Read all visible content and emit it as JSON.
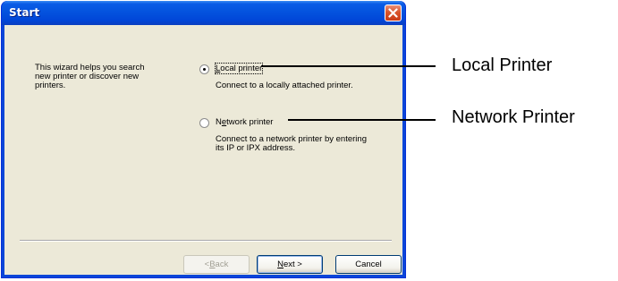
{
  "window": {
    "title": "Start",
    "close_icon": "close-icon"
  },
  "intro_text": "This wizard helps you search new printer or discover new printers.",
  "options": [
    {
      "label": "Local printer",
      "mnemonic": "L",
      "description": "Connect to a locally attached printer.",
      "selected": true
    },
    {
      "label": "Network printer",
      "mnemonic": "e",
      "description": "Connect to a network printer by entering its IP or IPX address.",
      "selected": false
    }
  ],
  "buttons": {
    "back": "< Back",
    "next": "Next >",
    "cancel": "Cancel"
  },
  "annotations": {
    "local": "Local Printer",
    "network": "Network Printer"
  },
  "colors": {
    "titlebar": "#0453de",
    "dialog_bg": "#ece9d8",
    "close_button": "#d9542b"
  }
}
